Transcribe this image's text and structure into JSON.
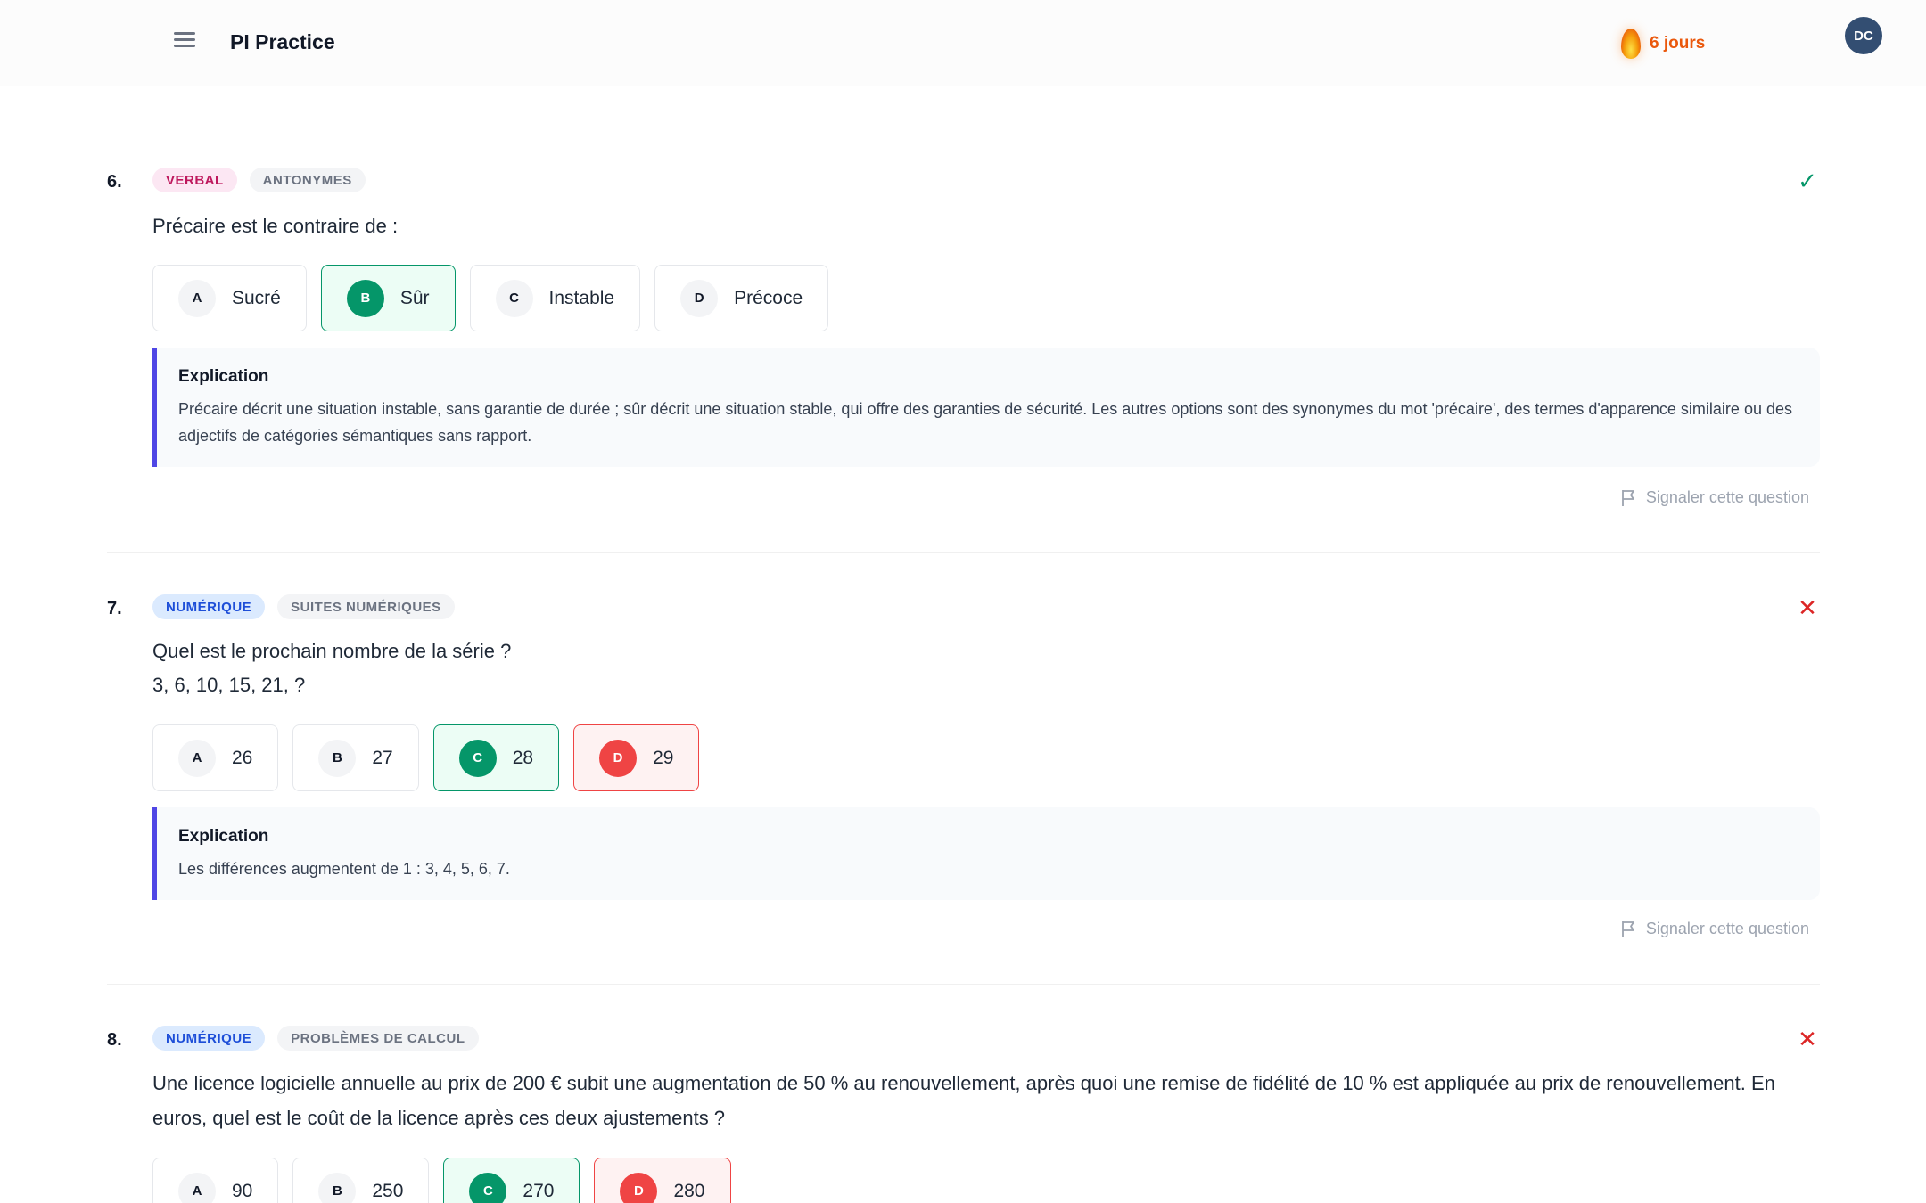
{
  "header": {
    "app_title": "PI Practice",
    "streak_label": "6 jours",
    "avatar_initials": "DC"
  },
  "report_label": "Signaler cette question",
  "explanation_title": "Explication",
  "questions": [
    {
      "number": "6.",
      "category": "VERBAL",
      "topic": "ANTONYMES",
      "status": "correct",
      "text_lines": [
        "Précaire est le contraire de :"
      ],
      "options": [
        {
          "letter": "A",
          "value": "Sucré",
          "state": "neutral"
        },
        {
          "letter": "B",
          "value": "Sûr",
          "state": "correct"
        },
        {
          "letter": "C",
          "value": "Instable",
          "state": "neutral"
        },
        {
          "letter": "D",
          "value": "Précoce",
          "state": "neutral"
        }
      ],
      "explanation": "Précaire décrit une situation instable, sans garantie de durée ; sûr décrit une situation stable, qui offre des garanties de sécurité. Les autres options sont des synonymes du mot 'précaire', des termes d'apparence similaire ou des adjectifs de catégories sémantiques sans rapport."
    },
    {
      "number": "7.",
      "category": "NUMÉRIQUE",
      "topic": "SUITES NUMÉRIQUES",
      "status": "incorrect",
      "text_lines": [
        "Quel est le prochain nombre de la série ?",
        "3, 6, 10, 15, 21, ?"
      ],
      "options": [
        {
          "letter": "A",
          "value": "26",
          "state": "neutral"
        },
        {
          "letter": "B",
          "value": "27",
          "state": "neutral"
        },
        {
          "letter": "C",
          "value": "28",
          "state": "correct"
        },
        {
          "letter": "D",
          "value": "29",
          "state": "wrong"
        }
      ],
      "explanation": "Les différences augmentent de 1 : 3, 4, 5, 6, 7."
    },
    {
      "number": "8.",
      "category": "NUMÉRIQUE",
      "topic": "PROBLÈMES DE CALCUL",
      "status": "incorrect",
      "text_lines": [
        "Une licence logicielle annuelle au prix de 200 € subit une augmentation de 50 % au renouvellement, après quoi une remise de fidélité de 10 % est appliquée au prix de renouvellement. En euros, quel est le coût de la licence après ces deux ajustements ?"
      ],
      "options": [
        {
          "letter": "A",
          "value": "90",
          "state": "neutral"
        },
        {
          "letter": "B",
          "value": "250",
          "state": "neutral"
        },
        {
          "letter": "C",
          "value": "270",
          "state": "correct"
        },
        {
          "letter": "D",
          "value": "280",
          "state": "wrong"
        }
      ]
    }
  ],
  "colors": {
    "correct": "#059669",
    "wrong": "#ef4444",
    "accent_border": "#4f46e5",
    "streak": "#ea580c"
  }
}
